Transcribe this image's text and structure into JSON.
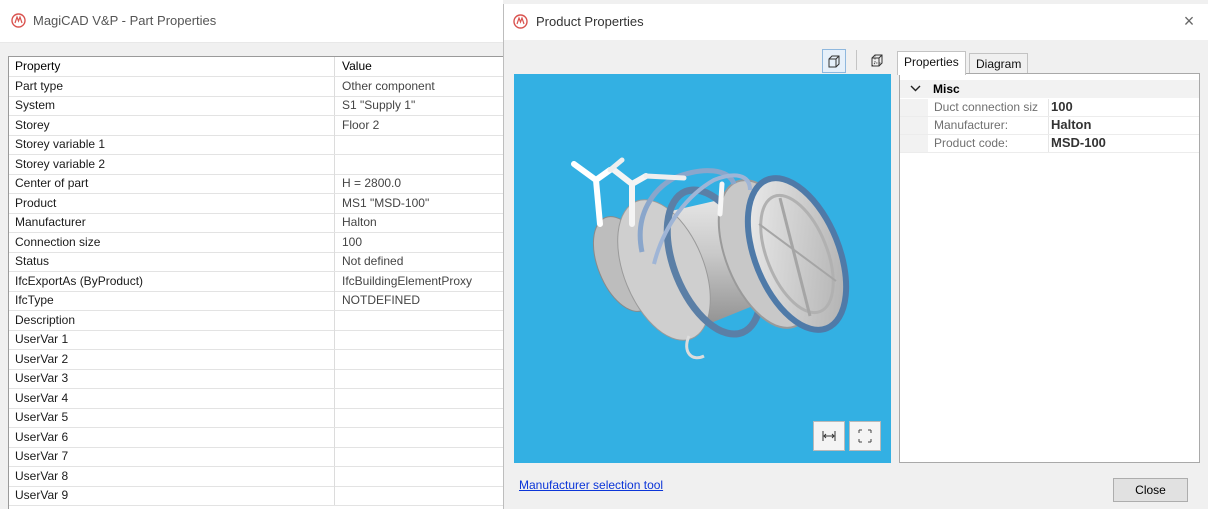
{
  "part_window": {
    "title": "MagiCAD V&P - Part Properties",
    "columns": [
      "Property",
      "Value"
    ],
    "rows": [
      [
        "Part type",
        "Other component"
      ],
      [
        "System",
        "S1 \"Supply 1\""
      ],
      [
        "Storey",
        "Floor 2"
      ],
      [
        "Storey variable 1",
        ""
      ],
      [
        "Storey variable 2",
        ""
      ],
      [
        "Center of part",
        "H = 2800.0"
      ],
      [
        "Product",
        "MS1 \"MSD-100\""
      ],
      [
        "Manufacturer",
        "Halton"
      ],
      [
        "Connection size",
        "100"
      ],
      [
        "Status",
        "Not defined"
      ],
      [
        "IfcExportAs (ByProduct)",
        "IfcBuildingElementProxy"
      ],
      [
        "IfcType",
        "NOTDEFINED"
      ],
      [
        "Description",
        ""
      ],
      [
        "UserVar 1",
        ""
      ],
      [
        "UserVar 2",
        ""
      ],
      [
        "UserVar 3",
        ""
      ],
      [
        "UserVar 4",
        ""
      ],
      [
        "UserVar 5",
        ""
      ],
      [
        "UserVar 6",
        ""
      ],
      [
        "UserVar 7",
        ""
      ],
      [
        "UserVar 8",
        ""
      ],
      [
        "UserVar 9",
        ""
      ]
    ]
  },
  "product_window": {
    "title": "Product Properties",
    "close_glyph": "×",
    "tabs": [
      "Properties",
      "Diagram"
    ],
    "active_tab": "Properties",
    "category": "Misc",
    "properties": [
      {
        "key": "Duct connection siz",
        "value": "100"
      },
      {
        "key": "Manufacturer:",
        "value": "Halton"
      },
      {
        "key": "Product code:",
        "value": "MSD-100"
      }
    ],
    "manufacturer_link": "Manufacturer selection tool",
    "close_button": "Close"
  },
  "icons": {
    "app_icon": "magicad-logo-icon",
    "view_3d": "solid-view-icon",
    "view_wire": "wireframe-view-icon",
    "fit": "fit-width-icon",
    "fullscreen": "fullscreen-icon",
    "expander": "chevron-down-icon"
  },
  "colors": {
    "viewer_background": "#33b0e3",
    "link": "#0b35d8",
    "logo": "#d9534f"
  }
}
